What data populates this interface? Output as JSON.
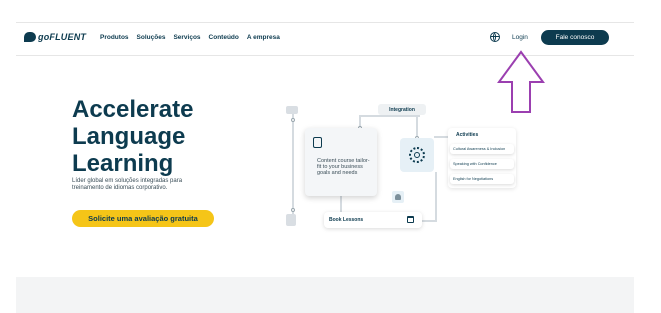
{
  "brand": {
    "logo_text": "goFLUENT"
  },
  "nav": {
    "items": [
      "Produtos",
      "Soluções",
      "Serviços",
      "Conteúdo",
      "A empresa"
    ],
    "login_label": "Login",
    "cta_label": "Fale conosco"
  },
  "hero": {
    "title_line1": "Accelerate",
    "title_line2": "Language",
    "title_line3": "Learning",
    "subtitle": "Líder global em soluções integradas para treinamento de idiomas corporativo.",
    "cta_label": "Solicite uma avaliação gratuita"
  },
  "illustration": {
    "integration_label": "Integration",
    "content_text": "Content course tailor-fit to your business goals and needs",
    "activities_title": "Activities",
    "activities": [
      "Cultural Awareness & Inclusion",
      "Speaking with Confidence",
      "English for Negotiations"
    ],
    "book_label": "Book Lessons"
  },
  "annotation": {
    "arrow_color": "#9b3fb0"
  },
  "colors": {
    "brand": "#0d3b4f",
    "accent": "#f5c518"
  }
}
